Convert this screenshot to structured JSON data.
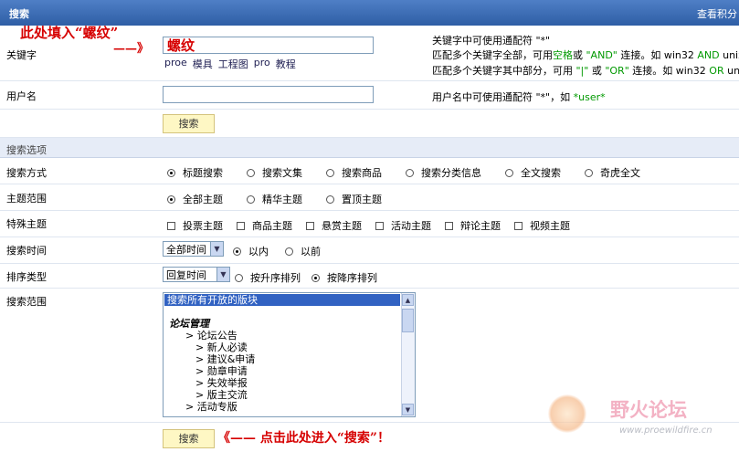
{
  "header": {
    "title": "搜索",
    "right_link": "查看积分"
  },
  "annotations": {
    "top_note": "此处填入“螺纹”",
    "arrow": "——》",
    "keyword_overlay": "螺纹",
    "bottom_note": "《—— 点击此处进入“搜索”！"
  },
  "keyword": {
    "label": "关键字",
    "value": "",
    "suggestions": [
      "proe",
      "模具",
      "工程图",
      "pro",
      "教程"
    ],
    "hint1": "关键字中可使用通配符 \"*\"",
    "hint2_a": "匹配多个关键字全部，可用",
    "hint2_b": "空格",
    "hint2_c": "或",
    "hint2_d": "\"AND\"",
    "hint2_e": "连接。如 win32",
    "hint2_f": "AND",
    "hint2_g": "unix",
    "hint3_a": "匹配多个关键字其中部分，可用",
    "hint3_b": "\"|\"",
    "hint3_c": "或",
    "hint3_d": "\"OR\"",
    "hint3_e": "连接。如 win32",
    "hint3_f": "OR",
    "hint3_g": "unix"
  },
  "username": {
    "label": "用户名",
    "value": "",
    "hint_a": "用户名中可使用通配符 \"*\"，如",
    "hint_b": "*user*"
  },
  "search_button": "搜索",
  "options_header": "搜索选项",
  "search_mode": {
    "label": "搜索方式",
    "options": [
      "标题搜索",
      "搜索文集",
      "搜索商品",
      "搜索分类信息",
      "全文搜索",
      "奇虎全文"
    ],
    "selected": 0
  },
  "topic_range": {
    "label": "主题范围",
    "options": [
      "全部主题",
      "精华主题",
      "置顶主题"
    ],
    "selected": 0
  },
  "special_topics": {
    "label": "特殊主题",
    "options": [
      "投票主题",
      "商品主题",
      "悬赏主题",
      "活动主题",
      "辩论主题",
      "视频主题"
    ]
  },
  "search_time": {
    "label": "搜索时间",
    "select_value": "全部时间",
    "options": [
      "以内",
      "以前"
    ],
    "selected": 0
  },
  "sort_type": {
    "label": "排序类型",
    "select_value": "回复时间",
    "options": [
      "按升序排列",
      "按降序排列"
    ],
    "selected": 1
  },
  "search_scope": {
    "label": "搜索范围",
    "items": [
      "搜索所有开放的版块",
      "",
      "论坛管理",
      "> 论坛公告",
      "> 新人必读",
      "> 建议&申请",
      "> 勋章申请",
      "> 失效举报",
      "> 版主交流",
      "> 活动专版"
    ]
  },
  "watermark": {
    "name": "野火论坛",
    "url": "www.proewildfire.cn"
  },
  "colors": {
    "header": "#3a6cb5",
    "accent_red": "#d60000",
    "green_hint": "#009900",
    "button_bg": "#fef7c4"
  }
}
